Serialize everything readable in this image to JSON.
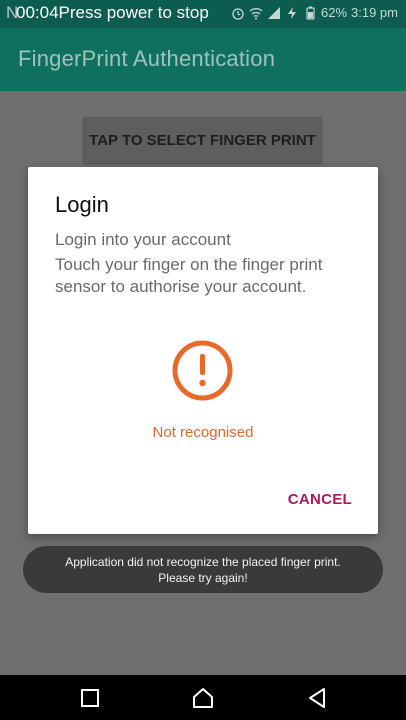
{
  "status_bar": {
    "recording_label": "00:04Press power to stop",
    "notification_glyph": "N",
    "battery": "62%",
    "time": "3:19 pm",
    "icons": [
      "alarm-icon",
      "wifi-icon",
      "signal-icon",
      "charging-icon",
      "battery-icon"
    ]
  },
  "app_bar": {
    "title": "FingerPrint Authentication"
  },
  "main": {
    "select_button_label": "TAP TO SELECT FINGER PRINT"
  },
  "dialog": {
    "title": "Login",
    "subtitle": "Login into your account",
    "description": "Touch your finger on the finger print sensor to authorise your account.",
    "status_text": "Not recognised",
    "cancel_label": "CANCEL",
    "alert_color": "#e86a2b",
    "cancel_color": "#b0195b"
  },
  "toast": {
    "line1": "Application did not recognize the placed finger print.",
    "line2": "Please try again!"
  },
  "nav_bar": {
    "buttons": [
      "recents-icon",
      "home-icon",
      "back-icon"
    ]
  },
  "colors": {
    "app_bar": "#10705f",
    "status_bar": "#0c5d4f",
    "scrim": "#6f6f6f"
  }
}
